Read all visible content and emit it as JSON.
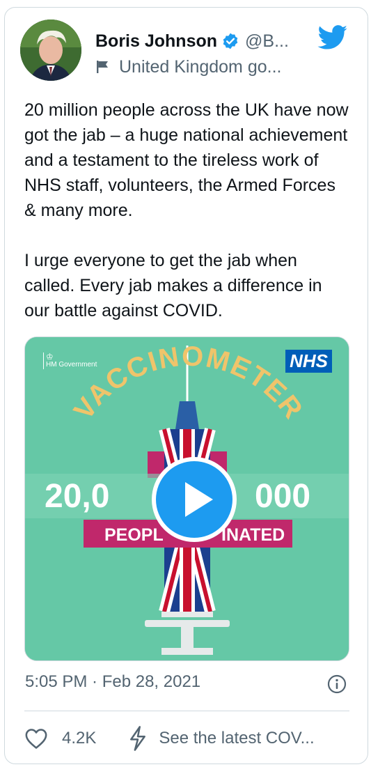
{
  "tweet": {
    "author_name": "Boris Johnson",
    "handle": "@B...",
    "affiliation": "United Kingdom go...",
    "paragraphs": [
      "20 million people across the UK have now got the jab – a huge national achievement and a testament to the tireless work of NHS staff, volunteers, the Armed Forces & many more.",
      "I urge everyone to get the jab when called. Every jab makes a difference in our battle against COVID."
    ],
    "timestamp": "5:05 PM · Feb 28, 2021",
    "like_count": "4.2K",
    "covid_link": "See the latest COV..."
  },
  "media": {
    "gov_label": "HM Government",
    "nhs_label": "NHS",
    "arc_title": "VACCINOMETER",
    "count_left": "20,0",
    "count_right": "000",
    "banner_left": "PEOPL",
    "banner_right": "INATED"
  },
  "colors": {
    "twitter_blue": "#1d9bf0",
    "verified_blue": "#1d9bf0",
    "media_bg": "#65c8a6",
    "banner_magenta": "#c0286b",
    "arc_text": "#efc46b",
    "nhs_blue": "#005eb8"
  },
  "icons": {
    "verified": "verified-badge-icon",
    "affiliation": "flag-icon",
    "brand": "twitter-bird-icon",
    "play": "play-icon",
    "info": "info-icon",
    "like": "heart-icon",
    "covid": "lightning-icon"
  }
}
